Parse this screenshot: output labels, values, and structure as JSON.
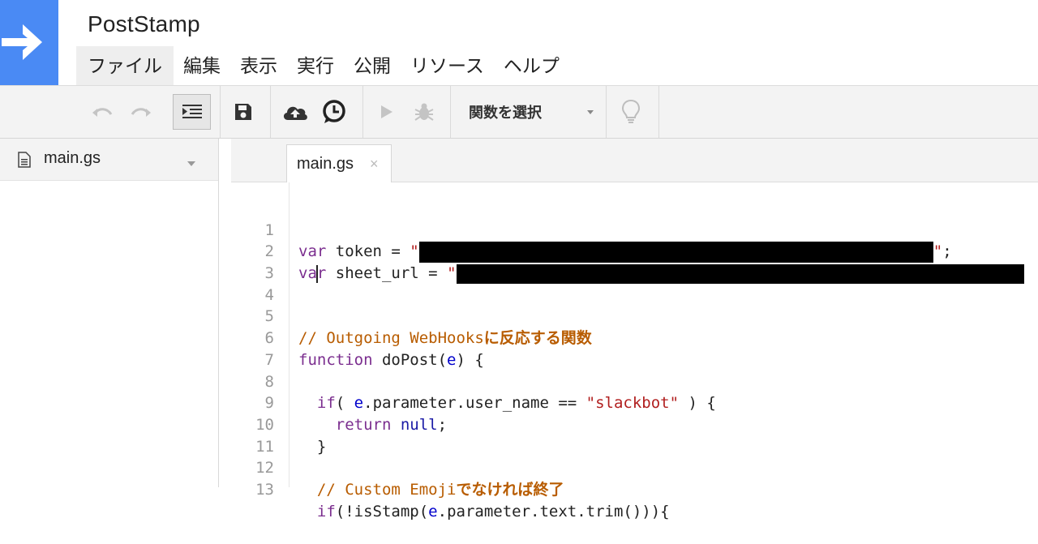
{
  "app": {
    "title": "PostStamp",
    "accent_color": "#4a8af4"
  },
  "menu": [
    "ファイル",
    "編集",
    "表示",
    "実行",
    "公開",
    "リソース",
    "ヘルプ"
  ],
  "toolbar": {
    "function_select_label": "関数を選択",
    "icons": [
      "undo-icon",
      "redo-icon",
      "indent-icon",
      "save-icon",
      "cloud-upload-icon",
      "clock-icon",
      "run-icon",
      "debug-icon",
      "lightbulb-icon"
    ]
  },
  "sidebar": {
    "files": [
      {
        "name": "main.gs"
      }
    ]
  },
  "editor": {
    "tab_label": "main.gs",
    "tab_close": "×",
    "lines": [
      {
        "num": "1"
      },
      {
        "num": "2"
      },
      {
        "num": "3"
      },
      {
        "num": "4"
      },
      {
        "num": "5"
      },
      {
        "num": "6"
      },
      {
        "num": "7"
      },
      {
        "num": "8"
      },
      {
        "num": "9"
      },
      {
        "num": "10"
      },
      {
        "num": "11"
      },
      {
        "num": "12"
      },
      {
        "num": "13"
      }
    ],
    "code": {
      "l1_kw": "var",
      "l1_rest": " token = ",
      "l1_q1": "\"",
      "l1_q2": "\"",
      "l1_end": ";",
      "l2_kw_a": "va",
      "l2_kw_b": "r",
      "l2_rest": " sheet_url = ",
      "l2_q1": "\"",
      "l5_cm": "// Outgoing WebHooks",
      "l5_cm_jp": "に反応する関数",
      "l6_kw": "function",
      "l6_name": " doPost(",
      "l6_arg": "e",
      "l6_end": ") {",
      "l8_indent": "  ",
      "l8_kw": "if",
      "l8_a": "( ",
      "l8_e": "e",
      "l8_b": ".parameter.user_name == ",
      "l8_str": "\"slackbot\"",
      "l8_c": " ) {",
      "l9_indent": "    ",
      "l9_kw": "return",
      "l9_sp": " ",
      "l9_null": "null",
      "l9_end": ";",
      "l10": "  }",
      "l12_indent": "  ",
      "l12_cm": "// Custom Emoji",
      "l12_cm_jp": "でなければ終了",
      "l13_indent": "  ",
      "l13_kw": "if",
      "l13_a": "(!isStamp(",
      "l13_e": "e",
      "l13_b": ".parameter.text.trim())){"
    }
  }
}
